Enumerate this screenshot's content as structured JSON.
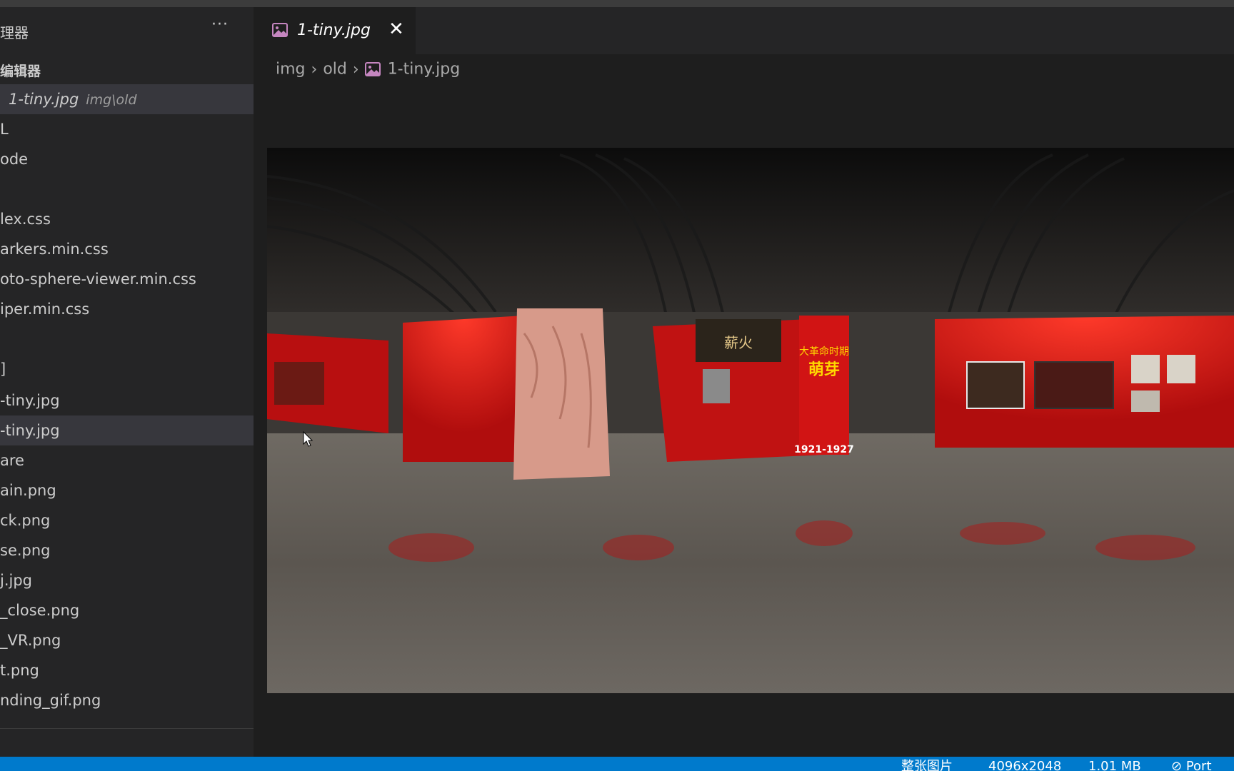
{
  "sidebar": {
    "title": "理器",
    "more_label": "···",
    "open_editors_label": "编辑器",
    "open_editor": {
      "name": "1-tiny.jpg",
      "path": "img\\old"
    },
    "items": [
      "L",
      "ode",
      "lex.css",
      "arkers.min.css",
      "oto-sphere-viewer.min.css",
      "iper.min.css",
      "]",
      "-tiny.jpg",
      "-tiny.jpg",
      "are",
      "ain.png",
      "ck.png",
      "se.png",
      "j.jpg",
      "_close.png",
      "_VR.png",
      "t.png",
      "nding_gif.png"
    ]
  },
  "tab": {
    "label": "1-tiny.jpg",
    "close_label": "✕"
  },
  "breadcrumb": {
    "part1": "img",
    "part2": "old",
    "file": "1-tiny.jpg",
    "sep": "›"
  },
  "image": {
    "sign_title": "大革命时期",
    "sign_subtitle": "萌芽",
    "sign_years": "1921-1927",
    "banner_text": "薪火"
  },
  "status": {
    "mode": "整张图片",
    "dimensions": "4096x2048",
    "size": "1.01 MB",
    "port": "Port"
  },
  "colors": {
    "accent": "#007acc",
    "sidebar_bg": "#252526",
    "editor_bg": "#1e1e1e",
    "selection": "#37373d",
    "image_icon": "#c586c0"
  }
}
